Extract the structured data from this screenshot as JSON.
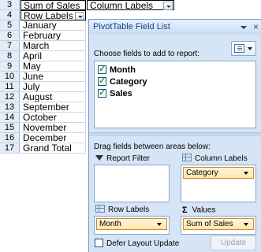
{
  "sheet": {
    "rows": [
      {
        "num": "3",
        "a": "Sum of Sales",
        "b": "Column Labels"
      },
      {
        "num": "4",
        "a": "Row Labels",
        "b": ""
      },
      {
        "num": "5",
        "a": "January",
        "b": ""
      },
      {
        "num": "6",
        "a": "February",
        "b": ""
      },
      {
        "num": "7",
        "a": "March",
        "b": ""
      },
      {
        "num": "8",
        "a": "April",
        "b": ""
      },
      {
        "num": "9",
        "a": "May",
        "b": ""
      },
      {
        "num": "10",
        "a": "June",
        "b": ""
      },
      {
        "num": "11",
        "a": "July",
        "b": ""
      },
      {
        "num": "12",
        "a": "August",
        "b": ""
      },
      {
        "num": "13",
        "a": "September",
        "b": ""
      },
      {
        "num": "14",
        "a": "October",
        "b": ""
      },
      {
        "num": "15",
        "a": "November",
        "b": ""
      },
      {
        "num": "16",
        "a": "December",
        "b": ""
      },
      {
        "num": "17",
        "a": "Grand Total",
        "b": ""
      }
    ]
  },
  "field_list": {
    "title": "PivotTable Field List",
    "close_glyph": "×",
    "choose_label": "Choose fields to add to report:",
    "fields": [
      {
        "label": "Month",
        "checked": true
      },
      {
        "label": "Category",
        "checked": true
      },
      {
        "label": "Sales",
        "checked": true
      }
    ],
    "drag_label": "Drag fields between areas below:",
    "areas": {
      "report_filter": {
        "label": "Report Filter",
        "icon": "filter-funnel-icon"
      },
      "column_labels": {
        "label": "Column Labels",
        "icon": "column-grid-icon",
        "chip": "Category"
      },
      "row_labels": {
        "label": "Row Labels",
        "icon": "row-grid-icon",
        "chip": "Month"
      },
      "values": {
        "label": "Values",
        "icon": "sigma-icon",
        "chip": "Sum of Sales"
      }
    },
    "defer_label": "Defer Layout Update",
    "defer_checked": false,
    "update_label": "Update"
  },
  "colors": {
    "pane_bg": "#d6e5f5",
    "title_text": "#15428b",
    "chip_bg": "#ffe4a7",
    "row_header_bg": "#e4ecf7"
  }
}
